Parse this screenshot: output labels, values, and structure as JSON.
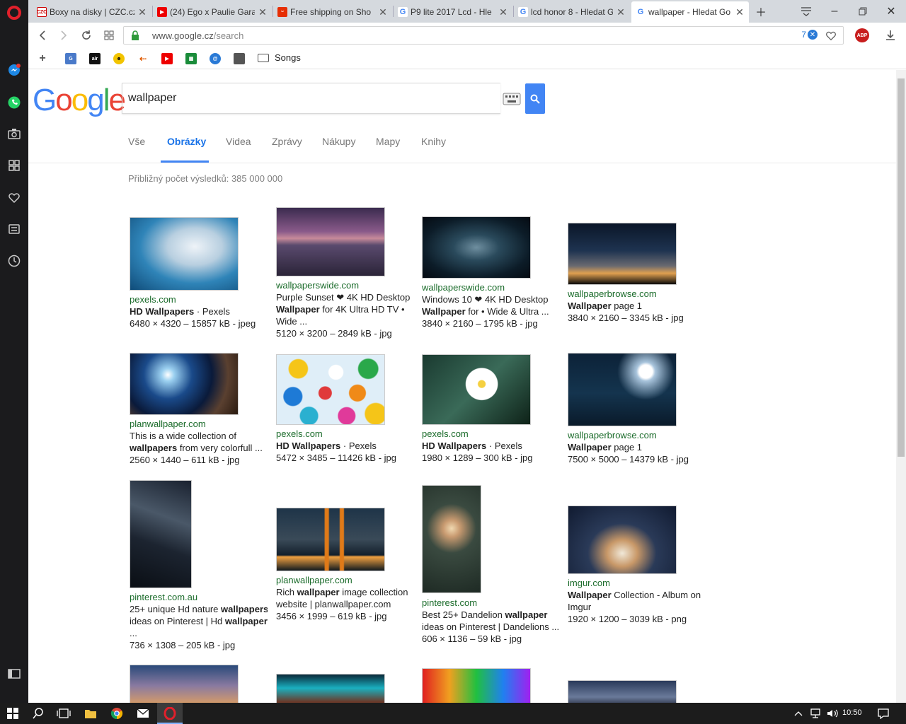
{
  "tabs": [
    {
      "title": "Boxy na disky | CZC.cz",
      "favicon": "czc-icon",
      "active": false
    },
    {
      "title": "(24) Ego x Paulie Gara",
      "favicon": "youtube-icon",
      "active": false
    },
    {
      "title": "Free shipping on Sho",
      "favicon": "aliexpress-icon",
      "active": false
    },
    {
      "title": "P9 lite 2017 Lcd - Hle",
      "favicon": "google-icon",
      "active": false
    },
    {
      "title": "lcd honor 8 - Hledat G",
      "favicon": "google-icon",
      "active": false
    },
    {
      "title": "wallpaper - Hledat Go",
      "favicon": "google-icon",
      "active": true
    }
  ],
  "address": {
    "domain": "www.google.cz",
    "path": "/search",
    "badge_count": "7"
  },
  "bookmarks": {
    "folder_label": "Songs"
  },
  "abp_label": "ABP",
  "search": {
    "query": "wallpaper"
  },
  "google_logo": [
    "G",
    "o",
    "o",
    "g",
    "l",
    "e"
  ],
  "nav_tabs": [
    {
      "label": "Vše",
      "active": false
    },
    {
      "label": "Obrázky",
      "active": true
    },
    {
      "label": "Videa",
      "active": false
    },
    {
      "label": "Zprávy",
      "active": false
    },
    {
      "label": "Nákupy",
      "active": false
    },
    {
      "label": "Mapy",
      "active": false
    },
    {
      "label": "Knihy",
      "active": false
    }
  ],
  "result_count": "Přibližný počet výsledků: 385 000 000",
  "results": [
    {
      "source": "pexels.com",
      "lines": [
        "<b>HD Wallpapers</b> · Pexels"
      ],
      "info": "6480 × 4320 – 15857 kB - jpeg"
    },
    {
      "source": "wallpaperswide.com",
      "lines": [
        "Purple Sunset ❤ 4K HD Desktop",
        "<b>Wallpaper</b> for 4K Ultra HD TV •",
        "Wide ..."
      ],
      "info": "5120 × 3200 – 2849 kB - jpg"
    },
    {
      "source": "wallpaperswide.com",
      "lines": [
        "Windows 10 ❤ 4K HD Desktop",
        "<b>Wallpaper</b> for • Wide & Ultra ..."
      ],
      "info": "3840 × 2160 – 1795 kB - jpg"
    },
    {
      "source": "wallpaperbrowse.com",
      "lines": [
        "<b>Wallpaper</b> page 1"
      ],
      "info": "3840 × 2160 – 3345 kB - jpg"
    },
    {
      "source": "planwallpaper.com",
      "lines": [
        "This is a wide collection of",
        "<b>wallpapers</b> from very colorfull ..."
      ],
      "info": "2560 × 1440 – 611 kB - jpg"
    },
    {
      "source": "pexels.com",
      "lines": [
        "<b>HD Wallpapers</b> · Pexels"
      ],
      "info": "5472 × 3485 – 11426 kB - jpg"
    },
    {
      "source": "pexels.com",
      "lines": [
        "<b>HD Wallpapers</b> · Pexels"
      ],
      "info": "1980 × 1289 – 300 kB - jpg"
    },
    {
      "source": "wallpaperbrowse.com",
      "lines": [
        "<b>Wallpaper</b> page 1"
      ],
      "info": "7500 × 5000 – 14379 kB - jpg"
    },
    {
      "source": "pinterest.com.au",
      "lines": [
        "25+ unique Hd nature <b>wallpapers</b>",
        "ideas on Pinterest | Hd <b>wallpaper</b>",
        "..."
      ],
      "info": "736 × 1308 – 205 kB - jpg"
    },
    {
      "source": "planwallpaper.com",
      "lines": [
        "Rich <b>wallpaper</b> image collection",
        "website | planwallpaper.com"
      ],
      "info": "3456 × 1999 – 619 kB - jpg"
    },
    {
      "source": "pinterest.com",
      "lines": [
        "Best 25+ Dandelion <b>wallpaper</b>",
        "ideas on Pinterest | Dandelions ..."
      ],
      "info": "606 × 1136 – 59 kB - jpg"
    },
    {
      "source": "imgur.com",
      "lines": [
        "<b>Wallpaper</b> Collection - Album on",
        "Imgur"
      ],
      "info": "1920 × 1200 – 3039 kB - png"
    }
  ],
  "taskbar": {
    "time": "10:50"
  },
  "colors": {
    "accent": "#4285f4",
    "source_green": "#1a6b2a",
    "opera_red": "#e2202b"
  }
}
